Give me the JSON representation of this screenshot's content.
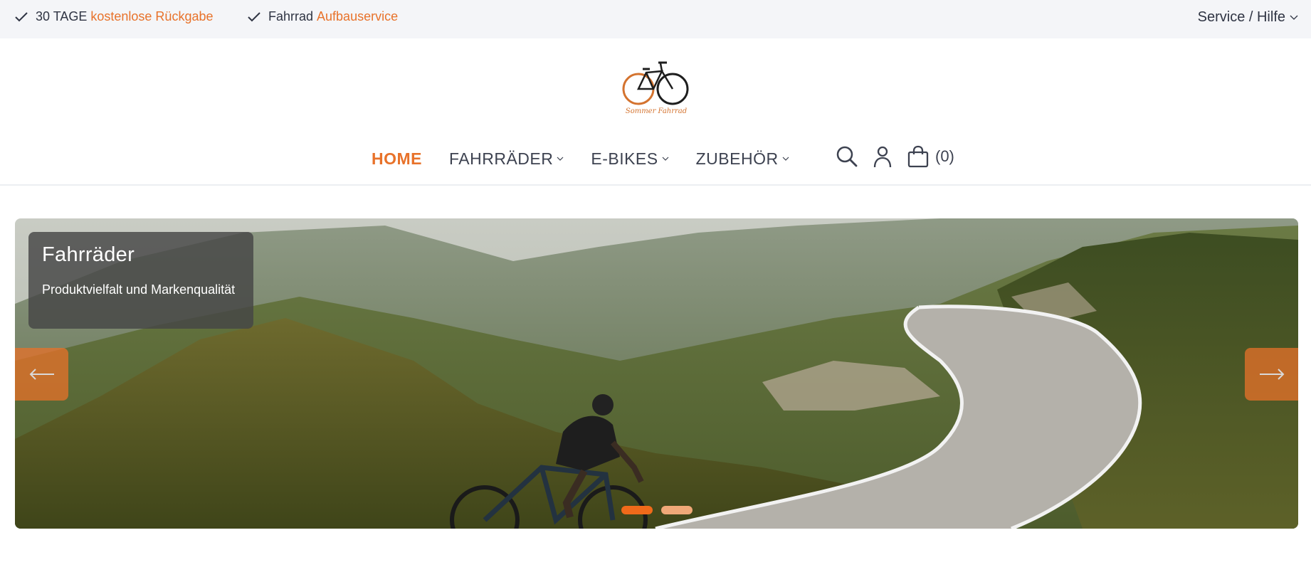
{
  "topbar": {
    "usp1": {
      "prefix": "30 TAGE",
      "highlight": "kostenlose Rückgabe"
    },
    "usp2": {
      "prefix": "Fahrrad",
      "highlight": "Aufbauservice"
    },
    "service_label": "Service / Hilfe"
  },
  "header": {
    "logo_text": "Sommer Fahrrad",
    "nav": [
      {
        "label": "HOME",
        "active": true
      },
      {
        "label": "FAHRRÄDER",
        "dropdown": true
      },
      {
        "label": "E-BIKES",
        "dropdown": true
      },
      {
        "label": "ZUBEHÖR",
        "dropdown": true
      }
    ],
    "cart_count": "(0)"
  },
  "hero": {
    "caption_title": "Fahrräder",
    "caption_subtitle": "Produktvielfalt und Markenqualität",
    "slides_total": 2,
    "active_slide": 1
  },
  "colors": {
    "accent": "#e8722a",
    "text": "#2f3443",
    "topbar_bg": "#f4f5f8"
  },
  "icons": [
    "check-icon",
    "chevron-down-icon",
    "search-icon",
    "user-icon",
    "cart-icon",
    "arrow-left-icon",
    "arrow-right-icon"
  ]
}
